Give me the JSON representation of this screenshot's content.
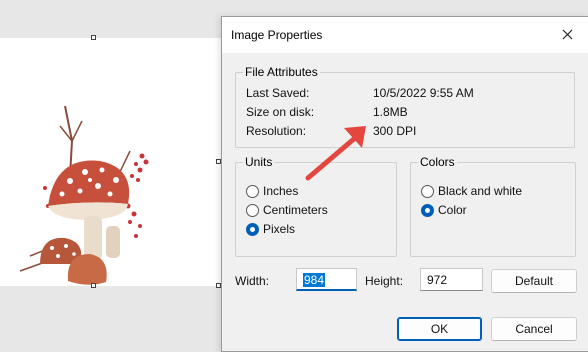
{
  "dialog": {
    "title": "Image Properties",
    "close_label": "✕"
  },
  "file_attributes": {
    "legend": "File Attributes",
    "rows": [
      {
        "label": "Last Saved:",
        "value": "10/5/2022 9:55 AM"
      },
      {
        "label": "Size on disk:",
        "value": "1.8MB"
      },
      {
        "label": "Resolution:",
        "value": "300 DPI"
      }
    ]
  },
  "units": {
    "legend": "Units",
    "options": [
      {
        "label": "Inches",
        "selected": false
      },
      {
        "label": "Centimeters",
        "selected": false
      },
      {
        "label": "Pixels",
        "selected": true
      }
    ]
  },
  "colors": {
    "legend": "Colors",
    "options": [
      {
        "label": "Black and white",
        "selected": false
      },
      {
        "label": "Color",
        "selected": true
      }
    ]
  },
  "size": {
    "width_label": "Width:",
    "width_value": "984",
    "height_label": "Height:",
    "height_value": "972",
    "default_label": "Default"
  },
  "buttons": {
    "ok_label": "OK",
    "cancel_label": "Cancel"
  },
  "colors_palette": {
    "accent": "#005fb8",
    "arrow": "#e5453f",
    "selection": "#0078d4"
  }
}
